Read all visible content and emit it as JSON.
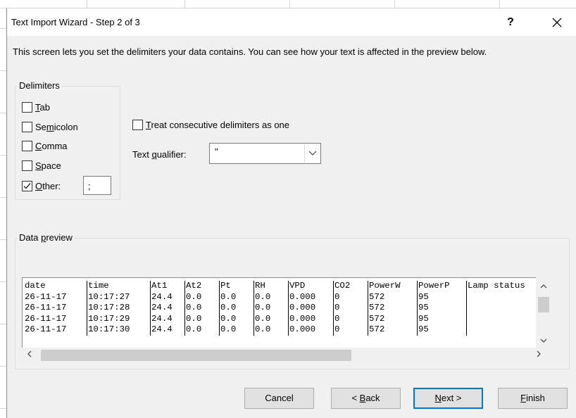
{
  "dialog": {
    "title": "Text Import Wizard - Step 2 of 3",
    "help_label": "?",
    "description": "This screen lets you set the delimiters your data contains.  You can see how your text is affected in the preview below."
  },
  "delimiters": {
    "group_label": "Delimiters",
    "options": [
      {
        "pre": "",
        "key": "T",
        "post": "ab",
        "checked": false
      },
      {
        "pre": "Se",
        "key": "m",
        "post": "icolon",
        "checked": false
      },
      {
        "pre": "",
        "key": "C",
        "post": "omma",
        "checked": false
      },
      {
        "pre": "",
        "key": "S",
        "post": "pace",
        "checked": false
      },
      {
        "pre": "",
        "key": "O",
        "post": "ther:",
        "checked": true
      }
    ],
    "other_value": ";"
  },
  "consecutive": {
    "pre": "",
    "key": "T",
    "post": "reat consecutive delimiters as one",
    "checked": false
  },
  "qualifier": {
    "pre": "Text ",
    "key": "q",
    "post": "ualifier:",
    "value": "\""
  },
  "preview": {
    "label_pre": "Data ",
    "label_key": "p",
    "label_post": "review",
    "columns": [
      "date",
      "time",
      "At1",
      "At2",
      "Pt",
      "RH",
      "VPD",
      "CO2",
      "PowerW",
      "PowerP",
      "Lamp status"
    ],
    "rows": [
      [
        "26-11-17",
        "10:17:27",
        "24.4",
        "0.0",
        "0.0",
        "0.0",
        "0.000",
        "0",
        "572",
        "95",
        ""
      ],
      [
        "26-11-17",
        "10:17:28",
        "24.4",
        "0.0",
        "0.0",
        "0.0",
        "0.000",
        "0",
        "572",
        "95",
        ""
      ],
      [
        "26-11-17",
        "10:17:29",
        "24.4",
        "0.0",
        "0.0",
        "0.0",
        "0.000",
        "0",
        "572",
        "95",
        ""
      ],
      [
        "26-11-17",
        "10:17:30",
        "24.4",
        "0.0",
        "0.0",
        "0.0",
        "0.000",
        "0",
        "572",
        "95",
        ""
      ]
    ]
  },
  "buttons": {
    "cancel": "Cancel",
    "back_pre": "< ",
    "back_key": "B",
    "back_post": "ack",
    "next_key": "N",
    "next_post": "ext >",
    "finish_key": "F",
    "finish_post": "inish"
  },
  "colors": {
    "accent": "#0078d7"
  }
}
